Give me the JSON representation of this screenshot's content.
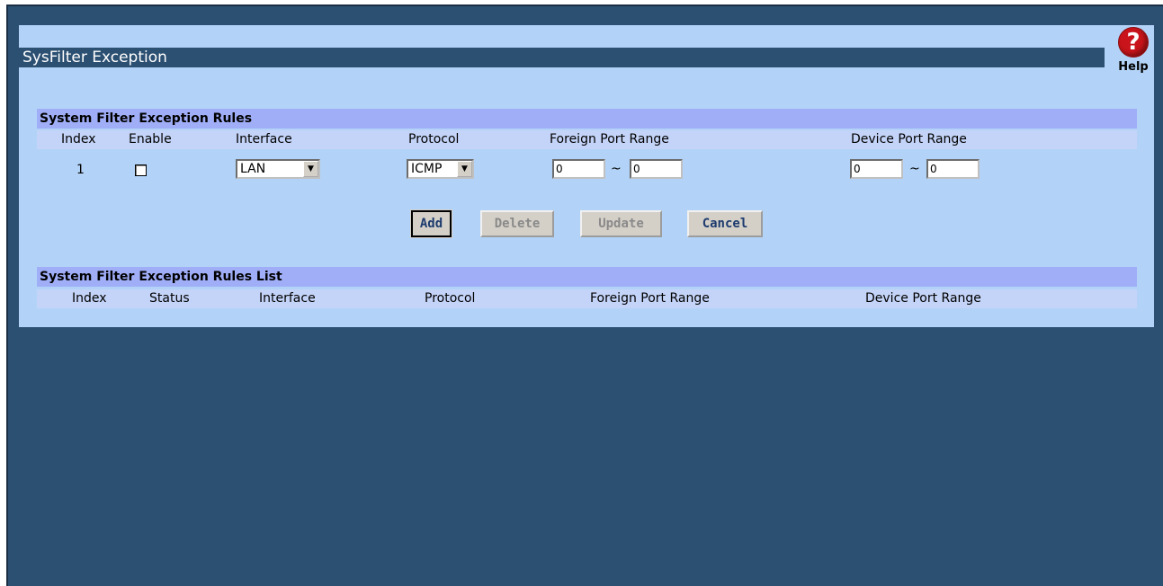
{
  "page": {
    "title": "SysFilter Exception",
    "help_label": "Help",
    "help_icon_glyph": "?"
  },
  "rules": {
    "section_title": "System Filter Exception Rules",
    "columns": [
      "Index",
      "Enable",
      "Interface",
      "Protocol",
      "Foreign Port Range",
      "Device Port Range"
    ],
    "row": {
      "index": "1",
      "enable_checked": false,
      "interface_value": "LAN",
      "protocol_value": "ICMP",
      "foreign_port_from": "0",
      "foreign_port_to": "0",
      "device_port_from": "0",
      "device_port_to": "0",
      "range_separator": "~"
    }
  },
  "buttons": {
    "add": "Add",
    "delete": "Delete",
    "update": "Update",
    "cancel": "Cancel"
  },
  "list": {
    "section_title": "System Filter Exception Rules List",
    "columns": [
      "Index",
      "Status",
      "Interface",
      "Protocol",
      "Foreign Port Range",
      "Device Port Range"
    ]
  },
  "colors": {
    "background": "#2c5072",
    "panel": "#b2d3f7",
    "section_header": "#a0aef8",
    "column_header": "#c4d4f8",
    "help_icon": "#c8141a"
  }
}
